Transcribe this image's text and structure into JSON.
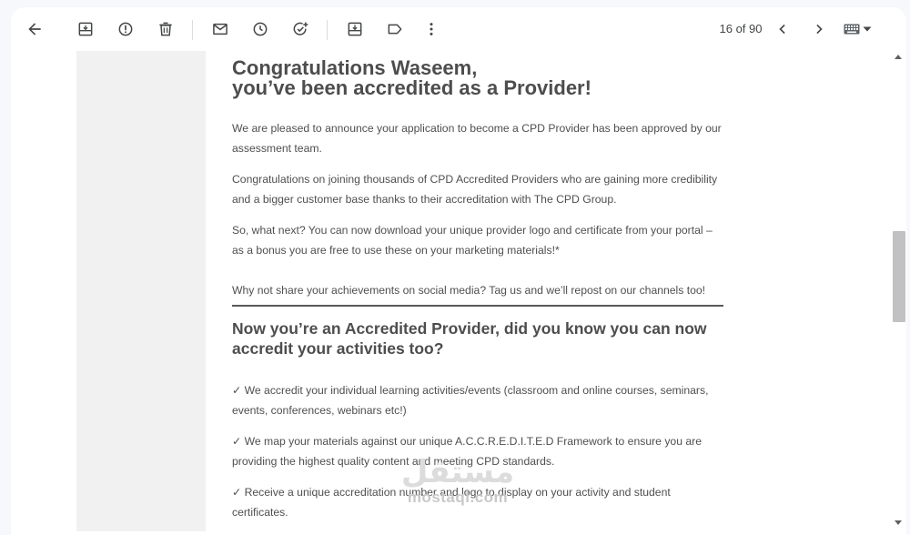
{
  "toolbar": {
    "icons": {
      "back": "arrow-back-icon",
      "archive": "archive-icon",
      "spam": "report-spam-icon",
      "delete": "trash-icon",
      "unread": "mark-unread-icon",
      "snooze": "snooze-clock-icon",
      "task": "add-task-icon",
      "move": "move-to-icon",
      "label": "label-icon",
      "more": "more-vert-icon",
      "older": "chevron-left-icon",
      "newer": "chevron-right-icon",
      "keyboard": "keyboard-icon"
    },
    "page_count": "16 of 90"
  },
  "email": {
    "heading_line1": "Congratulations Waseem,",
    "heading_line2": "you’ve been accredited as a Provider!",
    "paragraphs": [
      "We are pleased to announce your application to become a CPD Provider has been approved by our assessment team.",
      "Congratulations on joining thousands of CPD Accredited Providers who are gaining more credibility and a bigger customer base thanks to their accreditation with The CPD Group.",
      "So, what next? You can now download your unique provider logo and certificate from your portal – as a bonus you are free to use these on your marketing materials!*",
      "Why not share your achievements on social media? Tag us and we’ll repost on our channels too!"
    ],
    "subheading": "Now you’re an Accredited Provider, did you know you can now accredit your activities too?",
    "benefits": [
      "✓ We accredit your individual learning activities/events (classroom and online courses, seminars, events, conferences, webinars etc!)",
      "✓ We map your materials against our unique A.C.C.R.E.D.I.T.E.D Framework to ensure you are providing the highest quality content and meeting CPD standards.",
      "✓ Receive a unique accreditation number and logo to display on your activity and student certificates."
    ]
  },
  "watermark": {
    "arabic": "مستقل",
    "latin": "mostaql.com"
  },
  "colors": {
    "page_bg": "#f6f8fc",
    "email_bg": "#f1f1f1",
    "text": "#4f4f4f",
    "heading": "#4d4d4d",
    "icon": "#444746"
  }
}
